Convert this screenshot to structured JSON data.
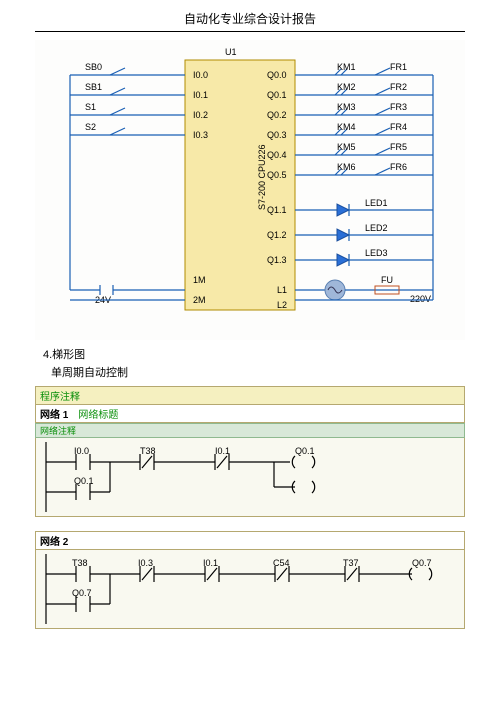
{
  "title": "自动化专业综合设计报告",
  "plc": {
    "module": "U1",
    "model": "S7-200  CPU226",
    "inputs": [
      {
        "label": "SB0",
        "pin": "I0.0"
      },
      {
        "label": "SB1",
        "pin": "I0.1"
      },
      {
        "label": "S1",
        "pin": "I0.2"
      },
      {
        "label": "S2",
        "pin": "I0.3"
      }
    ],
    "power": {
      "supply": "24V",
      "m1": "1M",
      "m2": "2M",
      "l1": "L1",
      "l2": "L2"
    },
    "outputs_km": [
      {
        "pin": "Q0.0",
        "km": "KM1",
        "fr": "FR1"
      },
      {
        "pin": "Q0.1",
        "km": "KM2",
        "fr": "FR2"
      },
      {
        "pin": "Q0.2",
        "km": "KM3",
        "fr": "FR3"
      },
      {
        "pin": "Q0.3",
        "km": "KM4",
        "fr": "FR4"
      },
      {
        "pin": "Q0.4",
        "km": "KM5",
        "fr": "FR5"
      },
      {
        "pin": "Q0.5",
        "km": "KM6",
        "fr": "FR6"
      }
    ],
    "outputs_led": [
      {
        "pin": "Q1.1",
        "led": "LED1"
      },
      {
        "pin": "Q1.2",
        "led": "LED2"
      },
      {
        "pin": "Q1.3",
        "led": "LED3"
      }
    ],
    "fuse": "FU",
    "ac": "220V"
  },
  "sec4": "4.梯形图",
  "sec4b": "单周期自动控制",
  "lad": {
    "prog_comment": "程序注释",
    "net1": {
      "title": "网络 1",
      "sub": "网络标题",
      "anno": "网络注释",
      "rungs": [
        {
          "x": "I0.0",
          "t": "T38",
          "i": "I0.1",
          "q": "Q0.1"
        },
        {
          "x": "Q0.1"
        }
      ]
    },
    "net2": {
      "title": "网络 2",
      "rungs": [
        {
          "t": "T38",
          "i3": "I0.3",
          "i1": "I0.1",
          "c": "C54",
          "t2": "T37",
          "q": "Q0.7"
        },
        {
          "x": "Q0.7"
        }
      ]
    }
  }
}
